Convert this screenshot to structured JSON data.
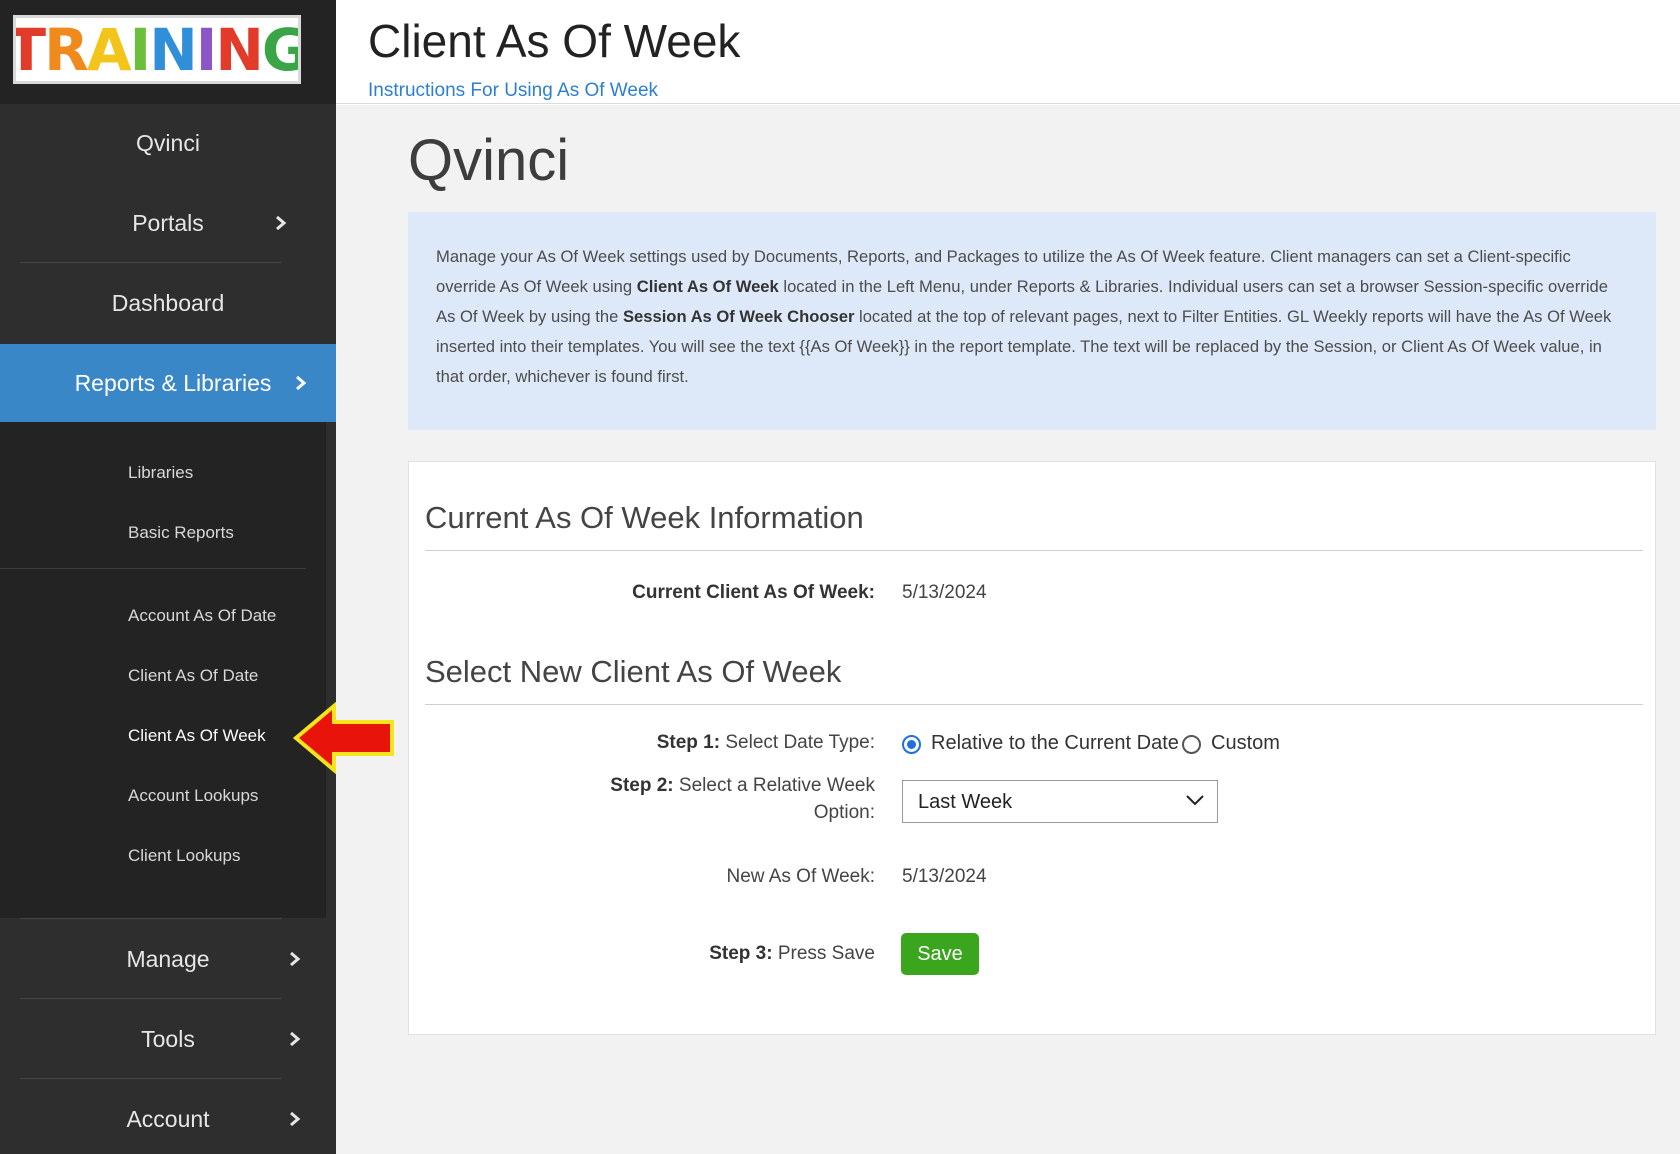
{
  "header": {
    "title": "Client As Of Week",
    "instructions_link": "Instructions For Using As Of Week"
  },
  "sidebar": {
    "logo_text": "TRAINING",
    "items": [
      {
        "label": "Qvinci"
      },
      {
        "label": "Portals"
      },
      {
        "label": "Dashboard"
      },
      {
        "label": "Reports & Libraries"
      },
      {
        "label": "Manage"
      },
      {
        "label": "Tools"
      },
      {
        "label": "Account"
      }
    ],
    "submenu": [
      {
        "label": "Libraries"
      },
      {
        "label": "Basic Reports"
      },
      {
        "label": "Account As Of Date"
      },
      {
        "label": "Client As Of Date"
      },
      {
        "label": "Client As Of Week"
      },
      {
        "label": "Account Lookups"
      },
      {
        "label": "Client Lookups"
      }
    ]
  },
  "main": {
    "brand": "Qvinci",
    "info": {
      "p1": "Manage your As Of Week settings used by Documents, Reports, and Packages to utilize the As Of Week feature. Client managers can set a Client-specific override As Of Week using ",
      "b1": "Client As Of Week",
      "p2": " located in the Left Menu, under Reports & Libraries. Individual users can set a browser Session-specific override As Of Week by using the ",
      "b2": "Session As Of Week Chooser",
      "p3": " located at the top of relevant pages, next to Filter Entities. GL Weekly reports will have the As Of Week inserted into their templates. You will see the text {{As Of Week}} in the report template. The text will be replaced by the Session, or Client As Of Week value, in that order, whichever is found first."
    },
    "current_section": {
      "heading": "Current As Of Week Information",
      "label": "Current Client As Of Week:",
      "value": "5/13/2024"
    },
    "new_section": {
      "heading": "Select New Client As Of Week",
      "step1_bold": "Step 1:",
      "step1_text": " Select Date Type:",
      "radio_relative": "Relative to the Current Date",
      "radio_custom": "Custom",
      "step2_bold": "Step 2:",
      "step2_text": " Select a Relative Week",
      "step2_text2": "Option:",
      "select_value": "Last Week",
      "new_label": "New As Of Week:",
      "new_value": "5/13/2024",
      "step3_bold": "Step 3:",
      "step3_text": " Press Save",
      "save_label": "Save"
    }
  },
  "colors": {
    "sidebar_bg": "#2e2e2e",
    "active_nav": "#3a87c8",
    "link": "#2d7fd1",
    "info_bg": "#dde9f8",
    "save_button": "#3aa61e",
    "radio_selected": "#1f6fe0",
    "callout_arrow": "#e8140c"
  },
  "icons": {
    "nav_chevron": "chevron-right-icon",
    "select_chevron": "chevron-down-icon",
    "callout": "left-arrow-icon"
  }
}
